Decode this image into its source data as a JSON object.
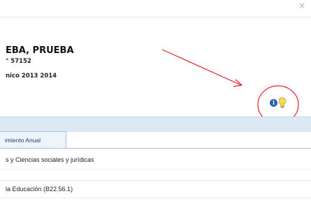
{
  "window": {
    "close_label": "×"
  },
  "student": {
    "name": "EBA, PRUEBA",
    "line1": "° 57152",
    "line2": "nico 2013 2014"
  },
  "tab": {
    "label": "imiento Anual"
  },
  "rows": [
    "s y Ciencias sociales y jurídicas",
    "la Educación (B22.56.1)"
  ],
  "icons": {
    "info": "info-icon",
    "bulb": "lightbulb-icon"
  },
  "colors": {
    "annotation": "#e8202a",
    "band": "#dde8f5",
    "tab_border": "#a9c1e0",
    "info_blue": "#1f63b8",
    "bulb_yellow": "#f4dc58"
  }
}
